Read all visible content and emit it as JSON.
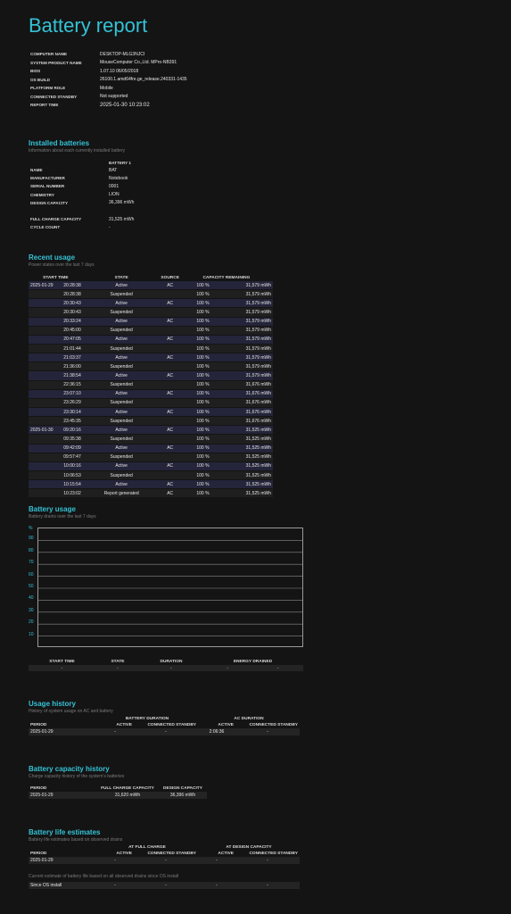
{
  "title": "Battery report",
  "system": [
    {
      "k": "COMPUTER NAME",
      "v": "DESKTOP-MLG3NJCI"
    },
    {
      "k": "SYSTEM PRODUCT NAME",
      "v": "MouseComputer Co.,Ltd. MPro-NB391"
    },
    {
      "k": "BIOS",
      "v": "1.07.10 06/05/2018"
    },
    {
      "k": "OS BUILD",
      "v": "26100.1.amd64fre.ge_release.240331-1435"
    },
    {
      "k": "PLATFORM ROLE",
      "v": "Mobile"
    },
    {
      "k": "CONNECTED STANDBY",
      "v": "Not supported"
    },
    {
      "k": "REPORT TIME",
      "v": "2025-01-30  10:23:02"
    }
  ],
  "installed": {
    "heading": "Installed batteries",
    "sub": "Information about each currently installed battery",
    "col": "BATTERY 1",
    "rows": [
      {
        "k": "NAME",
        "v": "BAT"
      },
      {
        "k": "MANUFACTURER",
        "v": "Notebook"
      },
      {
        "k": "SERIAL NUMBER",
        "v": "0001"
      },
      {
        "k": "CHEMISTRY",
        "v": "LION"
      },
      {
        "k": "DESIGN CAPACITY",
        "v": "36,396 mWh"
      },
      {
        "k": "",
        "v": ""
      },
      {
        "k": "FULL CHARGE CAPACITY",
        "v": "31,525 mWh"
      },
      {
        "k": "CYCLE COUNT",
        "v": "-"
      }
    ]
  },
  "recent": {
    "heading": "Recent usage",
    "sub": "Power states over the last 7 days",
    "headers": [
      "START TIME",
      "STATE",
      "SOURCE",
      "CAPACITY REMAINING"
    ],
    "rows": [
      [
        "2025-01-29",
        "20:28:38",
        "Active",
        "AC",
        "100 %",
        "31,579 mWh"
      ],
      [
        "",
        "20:28:38",
        "Suspended",
        "",
        "100 %",
        "31,579 mWh"
      ],
      [
        "",
        "20:30:43",
        "Active",
        "AC",
        "100 %",
        "31,579 mWh"
      ],
      [
        "",
        "20:30:43",
        "Suspended",
        "",
        "100 %",
        "31,579 mWh"
      ],
      [
        "",
        "20:33:24",
        "Active",
        "AC",
        "100 %",
        "31,579 mWh"
      ],
      [
        "",
        "20:45:00",
        "Suspended",
        "",
        "100 %",
        "31,579 mWh"
      ],
      [
        "",
        "20:47:05",
        "Active",
        "AC",
        "100 %",
        "31,579 mWh"
      ],
      [
        "",
        "21:01:44",
        "Suspended",
        "",
        "100 %",
        "31,579 mWh"
      ],
      [
        "",
        "21:03:37",
        "Active",
        "AC",
        "100 %",
        "31,579 mWh"
      ],
      [
        "",
        "21:36:00",
        "Suspended",
        "",
        "100 %",
        "31,579 mWh"
      ],
      [
        "",
        "21:38:54",
        "Active",
        "AC",
        "100 %",
        "31,579 mWh"
      ],
      [
        "",
        "22:36:15",
        "Suspended",
        "",
        "100 %",
        "31,676 mWh"
      ],
      [
        "",
        "23:07:10",
        "Active",
        "AC",
        "100 %",
        "31,676 mWh"
      ],
      [
        "",
        "23:26:29",
        "Suspended",
        "",
        "100 %",
        "31,676 mWh"
      ],
      [
        "",
        "23:30:14",
        "Active",
        "AC",
        "100 %",
        "31,676 mWh"
      ],
      [
        "",
        "23:45:35",
        "Suspended",
        "",
        "100 %",
        "31,676 mWh"
      ],
      [
        "2025-01-30",
        "09:20:16",
        "Active",
        "AC",
        "100 %",
        "31,525 mWh"
      ],
      [
        "",
        "09:35:38",
        "Suspended",
        "",
        "100 %",
        "31,525 mWh"
      ],
      [
        "",
        "09:42:09",
        "Active",
        "AC",
        "100 %",
        "31,525 mWh"
      ],
      [
        "",
        "09:57:47",
        "Suspended",
        "",
        "100 %",
        "31,525 mWh"
      ],
      [
        "",
        "10:00:16",
        "Active",
        "AC",
        "100 %",
        "31,525 mWh"
      ],
      [
        "",
        "10:06:53",
        "Suspended",
        "",
        "100 %",
        "31,525 mWh"
      ],
      [
        "",
        "10:15:54",
        "Active",
        "AC",
        "100 %",
        "31,525 mWh"
      ],
      [
        "",
        "10:23:02",
        "Report generated",
        "AC",
        "100 %",
        "31,525 mWh"
      ]
    ]
  },
  "usage": {
    "heading": "Battery usage",
    "sub": "Battery drains over the last 7 days",
    "yunit": "%",
    "yticks": [
      "90",
      "80",
      "70",
      "60",
      "50",
      "40",
      "30",
      "20",
      "10"
    ],
    "headers": [
      "START TIME",
      "STATE",
      "DURATION",
      "ENERGY DRAINED"
    ],
    "row": [
      "-",
      "-",
      "-",
      "-",
      "-"
    ]
  },
  "history": {
    "heading": "Usage history",
    "sub": "History of system usage on AC and battery",
    "group1": "BATTERY DURATION",
    "group2": "AC DURATION",
    "headers": [
      "PERIOD",
      "ACTIVE",
      "CONNECTED STANDBY",
      "ACTIVE",
      "CONNECTED STANDBY"
    ],
    "row": [
      "2025-01-29",
      "-",
      "-",
      "2:06:36",
      "-"
    ]
  },
  "capacity": {
    "heading": "Battery capacity history",
    "sub": "Charge capacity history of the system's batteries",
    "headers": [
      "PERIOD",
      "FULL CHARGE CAPACITY",
      "DESIGN CAPACITY"
    ],
    "row": [
      "2025-01-29",
      "31,620 mWh",
      "36,396 mWh"
    ]
  },
  "life": {
    "heading": "Battery life estimates",
    "sub": "Battery life estimates based on observed drains",
    "group1": "AT FULL CHARGE",
    "group2": "AT DESIGN CAPACITY",
    "headers": [
      "PERIOD",
      "ACTIVE",
      "CONNECTED STANDBY",
      "ACTIVE",
      "CONNECTED STANDBY"
    ],
    "row": [
      "2025-01-29",
      "-",
      "-",
      "-",
      "-"
    ],
    "note": "Current estimate of battery life based on all observed drains since OS install",
    "row2": [
      "Since OS install",
      "-",
      "-",
      "-",
      "-"
    ]
  },
  "colors": {
    "accent": "#35c2d6",
    "background": "#141414",
    "row_alt": "#24243a"
  }
}
